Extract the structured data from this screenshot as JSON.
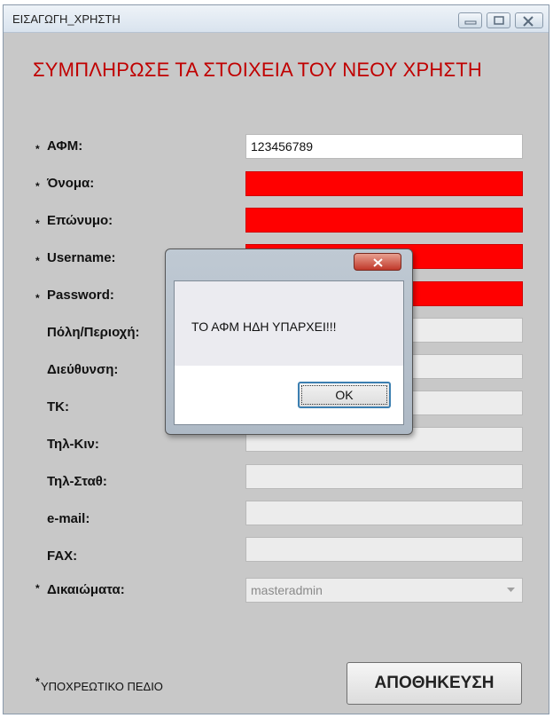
{
  "window": {
    "title": "ΕΙΣΑΓΩΓΗ_ΧΡΗΣΤΗ"
  },
  "heading": "ΣΥΜΠΛΗΡΩΣΕ ΤΑ ΣΤΟΙΧΕΙΑ ΤΟΥ ΝΕΟΥ ΧΡΗΣΤΗ",
  "fields": [
    {
      "required": true,
      "label": "ΑΦΜ:",
      "value": "123456789",
      "state": "white"
    },
    {
      "required": true,
      "label": "Όνομα:",
      "value": "",
      "state": "error"
    },
    {
      "required": true,
      "label": "Επώνυμο:",
      "value": "",
      "state": "error"
    },
    {
      "required": true,
      "label": "Username:",
      "value": "",
      "state": "error"
    },
    {
      "required": true,
      "label": "Password:",
      "value": "",
      "state": "error"
    },
    {
      "required": false,
      "label": "Πόλη/Περιοχή:",
      "value": "",
      "state": "disabled"
    },
    {
      "required": false,
      "label": "Διεύθυνση:",
      "value": "",
      "state": "disabled"
    },
    {
      "required": false,
      "label": "ΤΚ:",
      "value": "",
      "state": "disabled"
    },
    {
      "required": false,
      "label": "Τηλ-Κιν:",
      "value": "",
      "state": "disabled"
    },
    {
      "required": false,
      "label": "Τηλ-Σταθ:",
      "value": "",
      "state": "disabled"
    },
    {
      "required": false,
      "label": "e-mail:",
      "value": "",
      "state": "disabled"
    },
    {
      "required": false,
      "label": "FAX:",
      "value": "",
      "state": "disabled"
    }
  ],
  "rights": {
    "required": true,
    "label": "Δικαιώματα:",
    "selected": "masteradmin"
  },
  "required_marker": "*",
  "footer_note": "ΥΠΟΧΡΕΩΤΙΚΟ ΠΕΔΙΟ",
  "save_label": "ΑΠΟΘΗΚΕΥΣΗ",
  "dialog": {
    "message": "ΤΟ ΑΦΜ ΗΔΗ ΥΠΑΡΧΕΙ!!!",
    "ok_label": "OK"
  },
  "icons": {
    "minimize": "minimize-icon",
    "maximize": "maximize-icon",
    "close": "close-icon",
    "dropdown": "chevron-down-icon"
  },
  "colors": {
    "heading": "#c00000",
    "error_field": "#ff0000",
    "window_bg": "#c8c8c8"
  }
}
